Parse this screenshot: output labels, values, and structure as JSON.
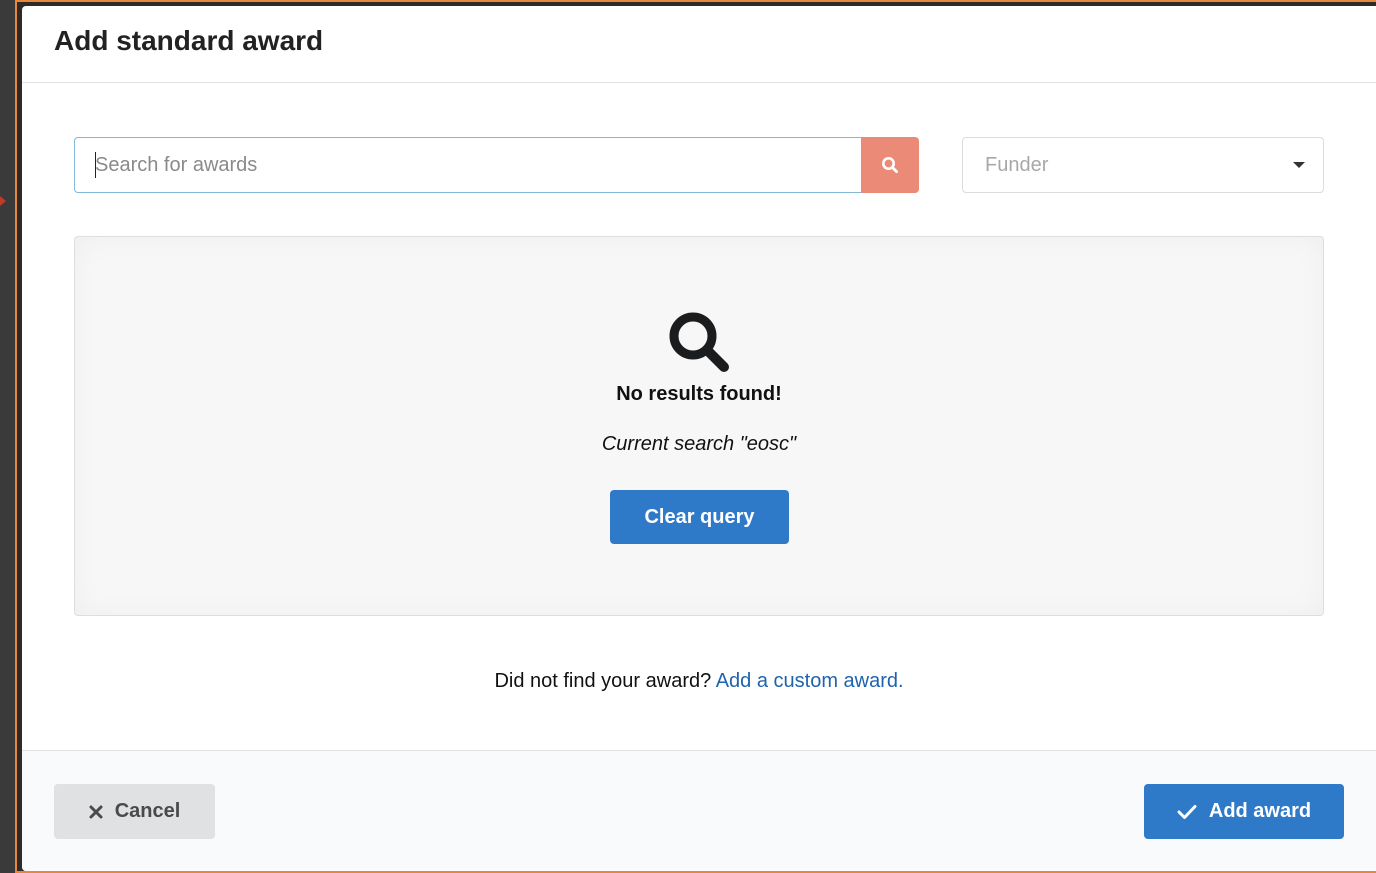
{
  "modal": {
    "title": "Add standard award"
  },
  "search": {
    "placeholder": "Search for awards",
    "value": "",
    "button_icon": "search-icon"
  },
  "funder": {
    "placeholder": "Funder",
    "icon": "dropdown-caret-icon"
  },
  "results": {
    "icon": "search-icon",
    "heading": "No results found!",
    "current_search": "Current search \"eosc\"",
    "clear_label": "Clear query"
  },
  "custom_award": {
    "prompt": "Did not find your award?",
    "link_label": "Add a custom award."
  },
  "footer": {
    "cancel_label": "Cancel",
    "cancel_icon": "close-icon",
    "add_label": "Add award",
    "add_icon": "checkmark-icon"
  },
  "colors": {
    "primary": "#2f79c9",
    "search_button": "#ec8a78",
    "link": "#1f63ad",
    "frame": "#e8863a"
  }
}
